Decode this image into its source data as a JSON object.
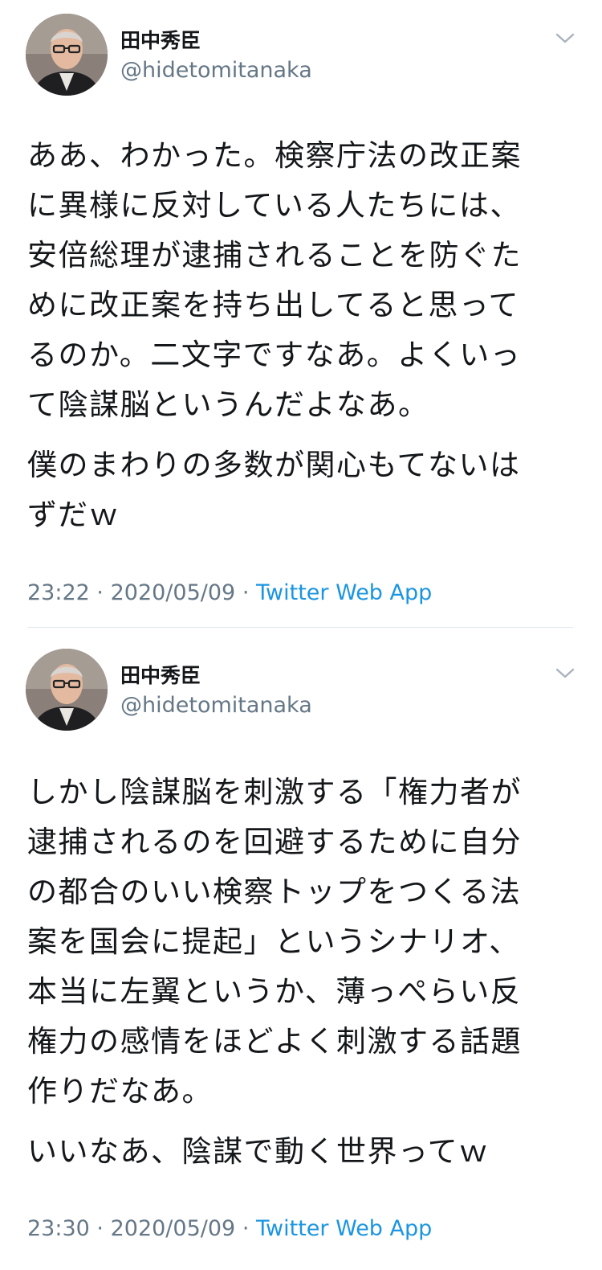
{
  "tweets": [
    {
      "display_name": "田中秀臣",
      "handle": "@hidetomitanaka",
      "paragraphs": [
        "ああ、わかった。検察庁法の改正案\nに異様に反対している人たちには、\n安倍総理が逮捕されることを防ぐた\nめに改正案を持ち出してると思って\nるのか。二文字ですなあ。よくいっ\nて陰謀脳というんだよなあ。",
        "僕のまわりの多数が関心もてないは\nずだｗ"
      ],
      "time": "23:22",
      "date": "2020/05/09",
      "separator": "·",
      "source": "Twitter Web App",
      "icons": {
        "avatar": "avatar-photo",
        "menu": "chevron-down-icon"
      }
    },
    {
      "display_name": "田中秀臣",
      "handle": "@hidetomitanaka",
      "paragraphs": [
        "しかし陰謀脳を刺激する「権力者が\n逮捕されるのを回避するために自分\nの都合のいい検察トップをつくる法\n案を国会に提起」というシナリオ、\n本当に左翼というか、薄っぺらい反\n権力の感情をほどよく刺激する話題\n作りだなあ。",
        "いいなあ、陰謀で動く世界ってｗ"
      ],
      "time": "23:30",
      "date": "2020/05/09",
      "separator": "·",
      "source": "Twitter Web App",
      "icons": {
        "avatar": "avatar-photo",
        "menu": "chevron-down-icon"
      }
    }
  ],
  "colors": {
    "text": "#14171a",
    "secondary": "#657786",
    "link": "#1b95e0",
    "divider": "#e1e8ed"
  }
}
